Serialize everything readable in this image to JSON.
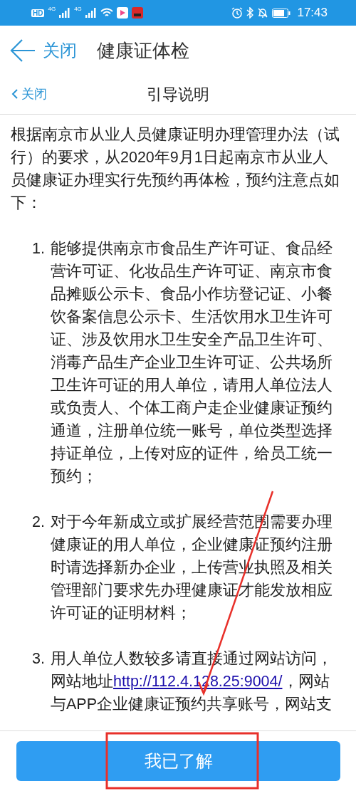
{
  "status_bar": {
    "time": "17:43",
    "hd": "HD",
    "network_labels": [
      "4G",
      "4G"
    ]
  },
  "app_bar": {
    "back_label": "关闭",
    "title": "健康证体检"
  },
  "sub_header": {
    "close_label": "关闭",
    "title": "引导说明"
  },
  "intro": "根据南京市从业人员健康证明办理管理办法（试行）的要求，从2020年9月1日起南京市从业人员健康证办理实行先预约再体检，预约注意点如下：",
  "items": [
    {
      "number": "1.",
      "parts": [
        {
          "kind": "text",
          "text": "能够提供南京市食品生产许可证、食品经营许可证、化妆品生产许可证、南京市食品摊贩公示卡、食品小作坊登记证、小餐饮备案信息公示卡、生活饮用水卫生许可证、涉及饮用水卫生安全产品卫生许可、消毒产品生产企业卫生许可证、公共场所卫生许可证的用人单位，请用人单位法人或负责人、个体工商户走企业健康证预约通道，注册单位统一账号，单位类型选择持证单位，上传对应的证件，给员工统一预约；"
        }
      ]
    },
    {
      "number": "2.",
      "parts": [
        {
          "kind": "text",
          "text": "对于今年新成立或扩展经营范围需要办理健康证的用人单位，企业健康证预约注册时请选择新办企业，上传营业执照及相关管理部门要求先办理健康证才能发放相应许可证的证明材料；"
        }
      ]
    },
    {
      "number": "3.",
      "parts": [
        {
          "kind": "text",
          "text": "用人单位人数较多请直接通过网站访问，网站地址"
        },
        {
          "kind": "link",
          "text": "http://112.4.128.25:9004/"
        },
        {
          "kind": "text",
          "text": "，网站与APP企业健康证预约共享账号，网站支"
        }
      ]
    }
  ],
  "confirm_button": "我已了解",
  "annotations": {
    "arrow": true,
    "highlight_box": true
  }
}
